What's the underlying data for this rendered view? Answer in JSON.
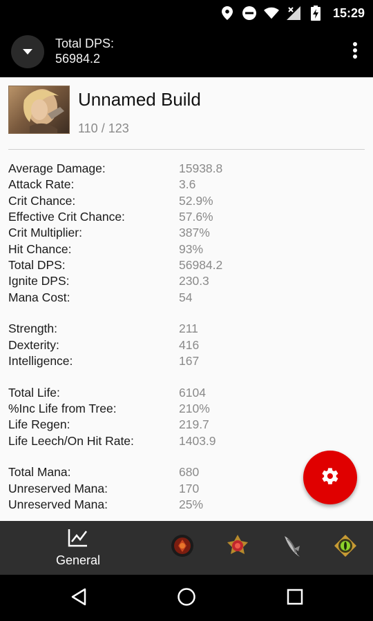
{
  "status_bar": {
    "time": "15:29",
    "icons": [
      "location-icon",
      "do-not-disturb-icon",
      "wifi-icon",
      "no-signal-icon",
      "battery-charging-icon"
    ]
  },
  "app_bar": {
    "title_line1": "Total DPS:",
    "title_line2": "56984.2",
    "collapse_icon": "chevron-down-icon",
    "overflow_icon": "more-vert-icon"
  },
  "build": {
    "name": "Unnamed Build",
    "level": "110 / 123"
  },
  "stats": {
    "offense": [
      {
        "label": "Average Damage:",
        "value": "15938.8"
      },
      {
        "label": "Attack Rate:",
        "value": "3.6"
      },
      {
        "label": "Crit Chance:",
        "value": "52.9%"
      },
      {
        "label": "Effective Crit Chance:",
        "value": "57.6%"
      },
      {
        "label": "Crit Multiplier:",
        "value": "387%"
      },
      {
        "label": "Hit Chance:",
        "value": "93%"
      },
      {
        "label": "Total DPS:",
        "value": "56984.2"
      },
      {
        "label": "Ignite DPS:",
        "value": "230.3"
      },
      {
        "label": "Mana Cost:",
        "value": "54"
      }
    ],
    "attributes": [
      {
        "label": "Strength:",
        "value": "211"
      },
      {
        "label": "Dexterity:",
        "value": "416"
      },
      {
        "label": "Intelligence:",
        "value": "167"
      }
    ],
    "life": [
      {
        "label": "Total Life:",
        "value": "6104"
      },
      {
        "label": "%Inc Life from Tree:",
        "value": "210%"
      },
      {
        "label": "Life Regen:",
        "value": "219.7"
      },
      {
        "label": "Life Leech/On Hit Rate:",
        "value": "1403.9"
      }
    ],
    "mana": [
      {
        "label": "Total Mana:",
        "value": "680"
      },
      {
        "label": "Unreserved Mana:",
        "value": "170"
      },
      {
        "label": "Unreserved Mana:",
        "value": "25%"
      }
    ]
  },
  "fab": {
    "icon": "settings-gear-icon"
  },
  "bottom_nav": {
    "general_label": "General",
    "general_icon": "line-chart-icon",
    "tabs": [
      "skill-gem-icon",
      "passive-tree-icon",
      "item-gear-icon",
      "jewel-icon"
    ]
  },
  "colors": {
    "app_bar": "#000000",
    "content_bg": "#fafafa",
    "label": "#1a1a1a",
    "value": "#8a8a8a",
    "accent_fab": "#e00000",
    "bottom_nav": "#2f2f2f"
  }
}
